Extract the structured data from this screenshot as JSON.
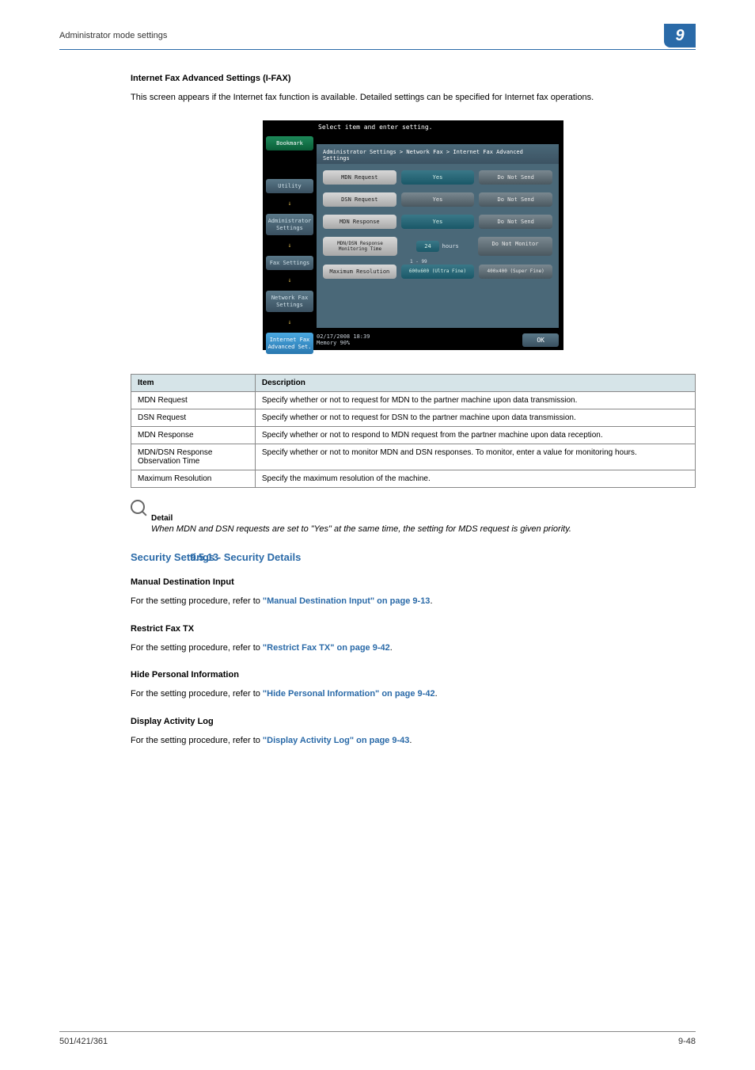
{
  "header": {
    "breadcrumb": "Administrator mode settings",
    "page_num": "9"
  },
  "section1": {
    "heading": "Internet Fax Advanced Settings (I-FAX)",
    "body": "This screen appears if the Internet fax function is available. Detailed settings can be specified for Internet fax operations."
  },
  "screenshot": {
    "top_instruction": "Select item and enter setting.",
    "breadcrumb": "Administrator Settings > Network Fax > Internet Fax Advanced Settings",
    "nav": {
      "bookmark": "Bookmark",
      "utility": "Utility",
      "admin": "Administrator Settings",
      "fax": "Fax Settings",
      "netfax": "Network Fax Settings",
      "ifax": "Internet Fax Advanced Set."
    },
    "rows": {
      "mdn_req": "MDN Request",
      "dsn_req": "DSN Request",
      "mdn_resp": "MDN Response",
      "mdn_dsn": "MDN/DSN Response Monitoring Time",
      "max_res": "Maximum Resolution",
      "yes": "Yes",
      "do_not_send": "Do Not Send",
      "hours_val": "24",
      "hours_label": "hours",
      "hours_range": "1 - 99",
      "do_not_monitor": "Do Not Monitor",
      "res1": "600x600 (Ultra Fine)",
      "res2": "400x400 (Super Fine)"
    },
    "footer": {
      "datetime": "02/17/2008  18:39",
      "memory": "Memory        90%",
      "ok": "OK"
    }
  },
  "table": {
    "header_item": "Item",
    "header_desc": "Description",
    "rows": [
      {
        "item": "MDN Request",
        "desc": "Specify whether or not to request for MDN to the partner machine upon data transmission."
      },
      {
        "item": "DSN Request",
        "desc": "Specify whether or not to request for DSN to the partner machine upon data transmission."
      },
      {
        "item": "MDN Response",
        "desc": "Specify whether or not to respond to MDN request from the partner machine upon data reception."
      },
      {
        "item": "MDN/DSN Response Observation Time",
        "desc": "Specify whether or not to monitor MDN and DSN responses. To monitor, enter a value for monitoring hours."
      },
      {
        "item": "Maximum Resolution",
        "desc": "Specify the maximum resolution of the machine."
      }
    ]
  },
  "detail_block": {
    "label": "Detail",
    "text": "When MDN and DSN requests are set to \"Yes\" at the same time, the setting for MDS request is given priority."
  },
  "section2": {
    "number": "9.5.13",
    "title": "Security Settings - Security Details",
    "subsections": [
      {
        "heading": "Manual Destination Input",
        "prefix": "For the setting procedure, refer to ",
        "link": "\"Manual Destination Input\" on page 9-13",
        "suffix": "."
      },
      {
        "heading": "Restrict Fax TX",
        "prefix": "For the setting procedure, refer to ",
        "link": "\"Restrict Fax TX\" on page 9-42",
        "suffix": "."
      },
      {
        "heading": "Hide Personal Information",
        "prefix": "For the setting procedure, refer to ",
        "link": "\"Hide Personal Information\" on page 9-42",
        "suffix": "."
      },
      {
        "heading": "Display Activity Log",
        "prefix": "For the setting procedure, refer to ",
        "link": "\"Display Activity Log\" on page 9-43",
        "suffix": "."
      }
    ]
  },
  "footer": {
    "left": "501/421/361",
    "right": "9-48"
  }
}
